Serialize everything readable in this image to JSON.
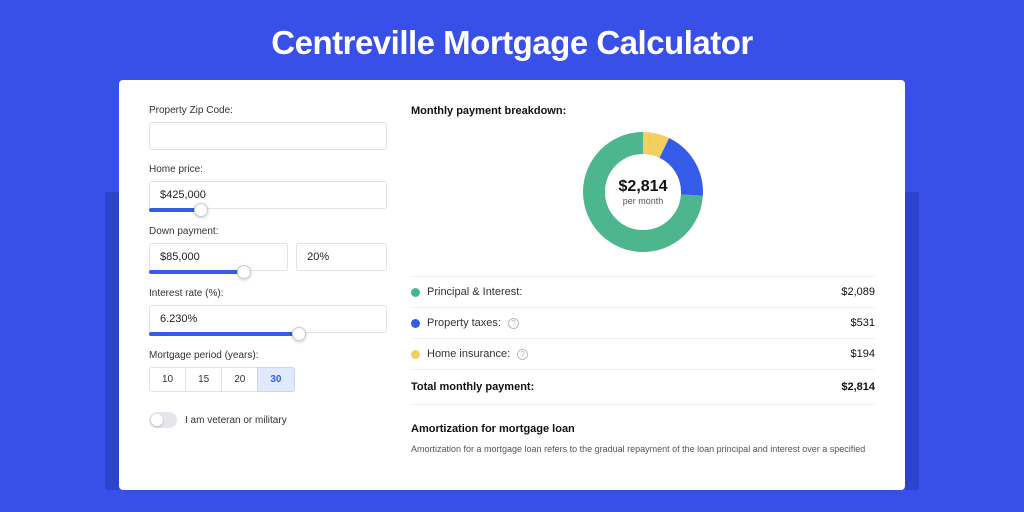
{
  "title": "Centreville Mortgage Calculator",
  "form": {
    "zip": {
      "label": "Property Zip Code:",
      "value": ""
    },
    "home_price": {
      "label": "Home price:",
      "value": "$425,000"
    },
    "down_payment": {
      "label": "Down payment:",
      "value": "$85,000",
      "pct": "20%"
    },
    "interest_rate": {
      "label": "Interest rate (%):",
      "value": "6.230%"
    },
    "period": {
      "label": "Mortgage period (years):",
      "options": [
        "10",
        "15",
        "20",
        "30"
      ],
      "selected": "30"
    },
    "veteran": {
      "label": "I am veteran or military"
    }
  },
  "breakdown": {
    "title": "Monthly payment breakdown:",
    "center_amount": "$2,814",
    "center_sub": "per month",
    "rows": [
      {
        "label": "Principal & Interest:",
        "value": "$2,089",
        "color": "#4DB68F",
        "info": false
      },
      {
        "label": "Property taxes:",
        "value": "$531",
        "color": "#355BE9",
        "info": true
      },
      {
        "label": "Home insurance:",
        "value": "$194",
        "color": "#F4CE5E",
        "info": true
      }
    ],
    "total_label": "Total monthly payment:",
    "total_value": "$2,814"
  },
  "amort": {
    "title": "Amortization for mortgage loan",
    "text": "Amortization for a mortgage loan refers to the gradual repayment of the loan principal and interest over a specified"
  },
  "chart_data": {
    "type": "pie",
    "title": "Monthly payment breakdown",
    "series": [
      {
        "name": "Principal & Interest",
        "value": 2089,
        "color": "#4DB68F"
      },
      {
        "name": "Property taxes",
        "value": 531,
        "color": "#355BE9"
      },
      {
        "name": "Home insurance",
        "value": 194,
        "color": "#F4CE5E"
      }
    ],
    "total": 2814,
    "center_label": "$2,814 per month"
  }
}
